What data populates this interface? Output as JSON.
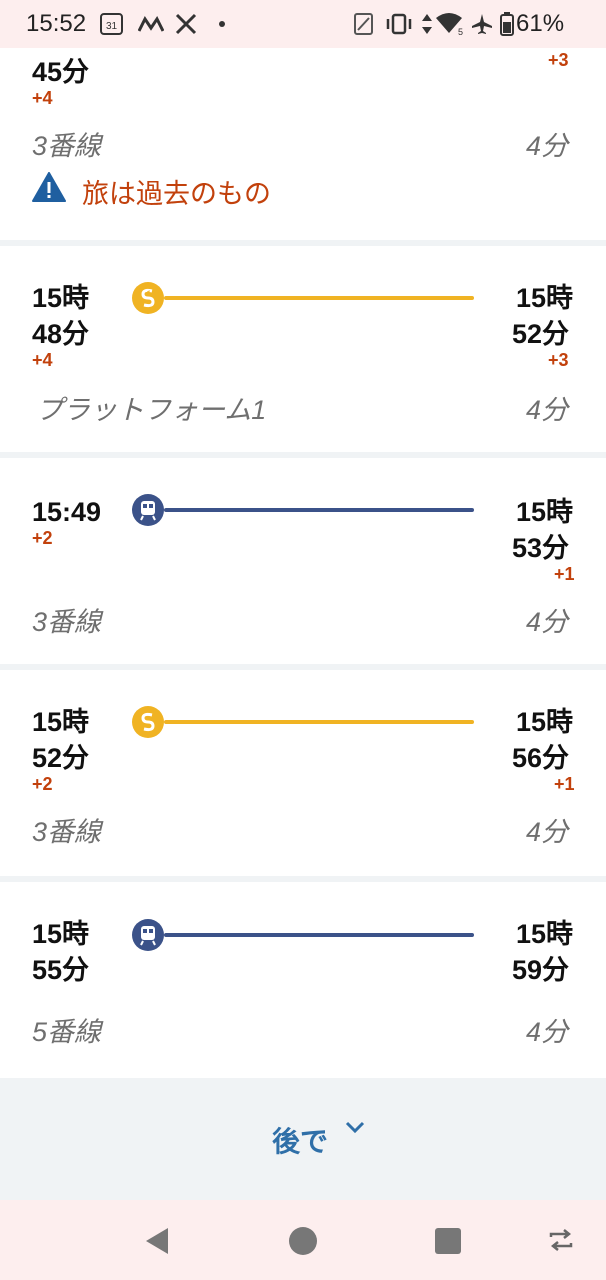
{
  "status_bar": {
    "time": "15:52",
    "calendar_day": "31",
    "battery": "61%",
    "wifi_badge": "5"
  },
  "top_card": {
    "depart_time": "45分",
    "depart_delay": "+4",
    "arrive_delay": "+3",
    "platform": "3番線",
    "duration": "4分",
    "warning": "旅は過去のもの"
  },
  "trips": [
    {
      "mode": "s-bahn",
      "depart": [
        "15時",
        "48分"
      ],
      "depart_delay": "+4",
      "arrive": [
        "15時",
        "52分"
      ],
      "arrive_delay": "+3",
      "platform": "プラットフォーム1",
      "duration": "4分"
    },
    {
      "mode": "train",
      "depart": [
        "15:49"
      ],
      "depart_delay": "+2",
      "arrive": [
        "15時",
        "53分"
      ],
      "arrive_delay": "+1",
      "platform": "3番線",
      "duration": "4分"
    },
    {
      "mode": "s-bahn",
      "depart": [
        "15時",
        "52分"
      ],
      "depart_delay": "+2",
      "arrive": [
        "15時",
        "56分"
      ],
      "arrive_delay": "+1",
      "platform": "3番線",
      "duration": "4分"
    },
    {
      "mode": "train",
      "depart": [
        "15時",
        "55分"
      ],
      "depart_delay": "",
      "arrive": [
        "15時",
        "59分"
      ],
      "arrive_delay": "",
      "platform": "5番線",
      "duration": "4分"
    }
  ],
  "later_button": {
    "label": "後で"
  },
  "colors": {
    "s_bahn": "#f0b323",
    "train": "#3b5289",
    "delay": "#c2410c",
    "accent": "#2f6fa8"
  }
}
